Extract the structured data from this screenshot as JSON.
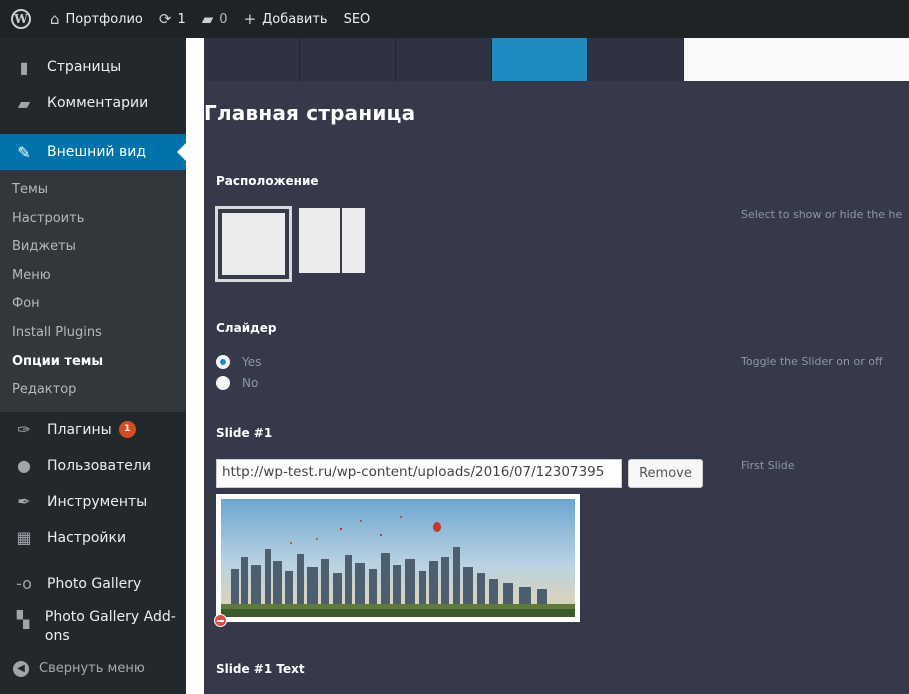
{
  "adminbar": {
    "site_name": "Портфолио",
    "updates_count": "1",
    "comments_count": "0",
    "add_new": "Добавить",
    "seo": "SEO"
  },
  "sidebar": {
    "pages": "Страницы",
    "comments": "Комментарии",
    "appearance": "Внешний вид",
    "submenu": [
      "Темы",
      "Настроить",
      "Виджеты",
      "Меню",
      "Фон",
      "Install Plugins",
      "Опции темы",
      "Редактор"
    ],
    "current_sub_index": 6,
    "plugins": "Плагины",
    "plugins_badge": "1",
    "users": "Пользователи",
    "tools": "Инструменты",
    "settings": "Настройки",
    "photo_gallery": "Photo Gallery",
    "photo_gallery_addons": "Photo Gallery Add-ons",
    "collapse": "Свернуть меню"
  },
  "main": {
    "page_title": "Главная страница",
    "layout": {
      "label": "Расположение",
      "description": "Select to show or hide the he"
    },
    "slider": {
      "label": "Слайдер",
      "options": [
        "Yes",
        "No"
      ],
      "selected": "Yes",
      "description": "Toggle the Slider on or off"
    },
    "slide1": {
      "label": "Slide #1",
      "url": "http://wp-test.ru/wp-content/uploads/2016/07/12307395",
      "remove_label": "Remove",
      "description": "First Slide"
    },
    "slide1_text": {
      "label": "Slide #1 Text"
    }
  },
  "colors": {
    "adminbar_bg": "#1f2326",
    "sidebar_bg": "#23282d",
    "submenu_bg": "#32373c",
    "accent": "#0073aa",
    "panel_bg": "#35394a",
    "active_tab": "#1e8cbe",
    "badge": "#d54e21"
  }
}
